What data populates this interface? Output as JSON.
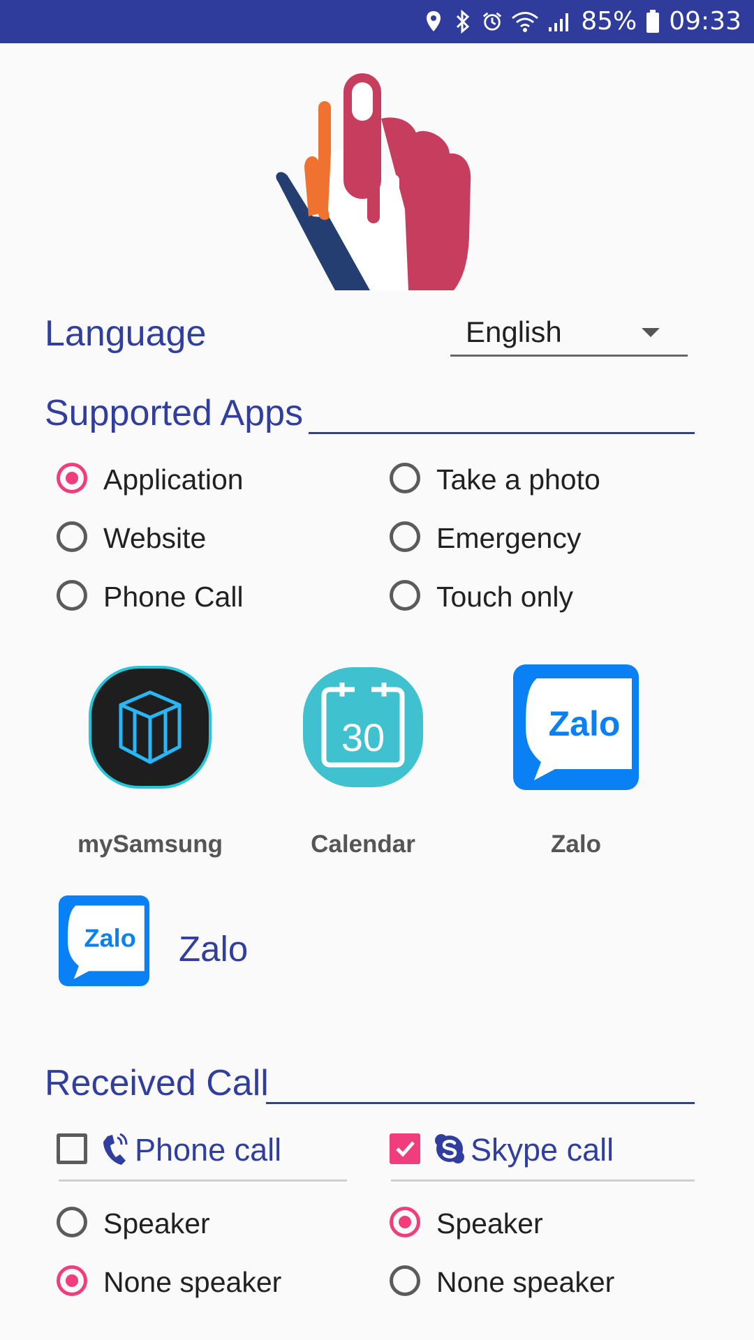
{
  "status_bar": {
    "battery": "85%",
    "time": "09:33",
    "icons": [
      "location-icon",
      "bluetooth-icon",
      "alarm-icon",
      "wifi-icon",
      "signal-icon",
      "battery-icon"
    ]
  },
  "language": {
    "label": "Language",
    "selected": "English"
  },
  "supported_apps": {
    "title": "Supported Apps",
    "options": [
      {
        "label": "Application",
        "selected": true
      },
      {
        "label": "Take a photo",
        "selected": false
      },
      {
        "label": "Website",
        "selected": false
      },
      {
        "label": "Emergency",
        "selected": false
      },
      {
        "label": "Phone Call",
        "selected": false
      },
      {
        "label": "Touch only",
        "selected": false
      }
    ],
    "apps": [
      {
        "name": "mySamsung",
        "icon": "mysamsung-icon"
      },
      {
        "name": "Calendar",
        "icon": "calendar-icon",
        "icon_text": "30"
      },
      {
        "name": "Zalo",
        "icon": "zalo-icon",
        "icon_text": "Zalo"
      }
    ],
    "selected_app": {
      "name": "Zalo",
      "icon": "zalo-icon",
      "icon_text": "Zalo"
    }
  },
  "received_call": {
    "title": "Received Call",
    "phone": {
      "label": "Phone call",
      "checked": false,
      "icon": "phone-ringing-icon",
      "options": [
        {
          "label": "Speaker",
          "selected": false
        },
        {
          "label": "None speaker",
          "selected": true
        }
      ]
    },
    "skype": {
      "label": "Skype call",
      "checked": true,
      "icon": "skype-icon",
      "options": [
        {
          "label": "Speaker",
          "selected": true
        },
        {
          "label": "None speaker",
          "selected": false
        }
      ]
    }
  },
  "colors": {
    "status_bar": "#2F3C9C",
    "accent": "#F03E7C",
    "primary_text": "#303F9F"
  }
}
